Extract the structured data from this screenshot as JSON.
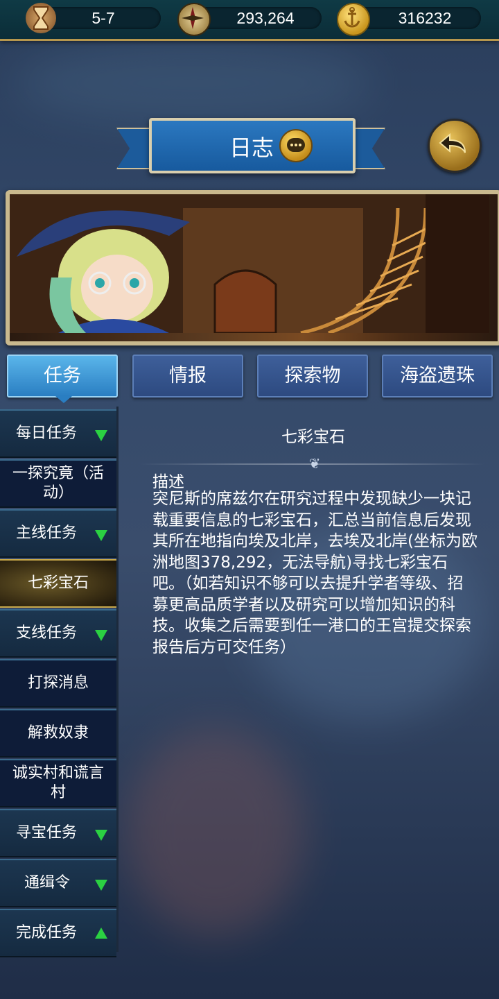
{
  "resources": {
    "timer": {
      "icon": "hourglass-icon",
      "value": "5-7"
    },
    "compass": {
      "icon": "compass-icon",
      "value": "293,264"
    },
    "gold": {
      "icon": "anchor-coin-icon",
      "value": "316232"
    }
  },
  "header": {
    "title": "日志",
    "chat_icon": "chat-icon",
    "back_icon": "back-arrow-icon"
  },
  "tabs": [
    {
      "label": "任务",
      "active": true
    },
    {
      "label": "情报",
      "active": false
    },
    {
      "label": "探索物",
      "active": false
    },
    {
      "label": "海盗遗珠",
      "active": false
    }
  ],
  "sidebar": {
    "items": [
      {
        "label": "每日任务",
        "expander": "down"
      },
      {
        "label": "一探究竟（活动）",
        "expander": null
      },
      {
        "label": "主线任务",
        "expander": "down"
      },
      {
        "label": "七彩宝石",
        "expander": null,
        "selected": true
      },
      {
        "label": "支线任务",
        "expander": "down"
      },
      {
        "label": "打探消息",
        "expander": null
      },
      {
        "label": "解救奴隶",
        "expander": null
      },
      {
        "label": "诚实村和谎言村",
        "expander": null
      },
      {
        "label": "寻宝任务",
        "expander": "down"
      },
      {
        "label": "通缉令",
        "expander": "down"
      },
      {
        "label": "完成任务",
        "expander": "up"
      }
    ]
  },
  "quest": {
    "title": "七彩宝石",
    "description_heading": "描述",
    "description": "突尼斯的席兹尔在研究过程中发现缺少一块记载重要信息的七彩宝石，汇总当前信息后发现其所在地指向埃及北岸，去埃及北岸(坐标为欧洲地图378,292，无法导航)寻找七彩宝石吧。（如若知识不够可以去提升学者等级、招募更高品质学者以及研究可以增加知识的科技。收集之后需要到任一港口的王宫提交探索报告后方可交任务）"
  },
  "colors": {
    "accent_green": "#2bd142",
    "tab_active": "#2a7ec2",
    "tab_inactive": "#2d4a80",
    "gold_border": "#c9a94a"
  }
}
